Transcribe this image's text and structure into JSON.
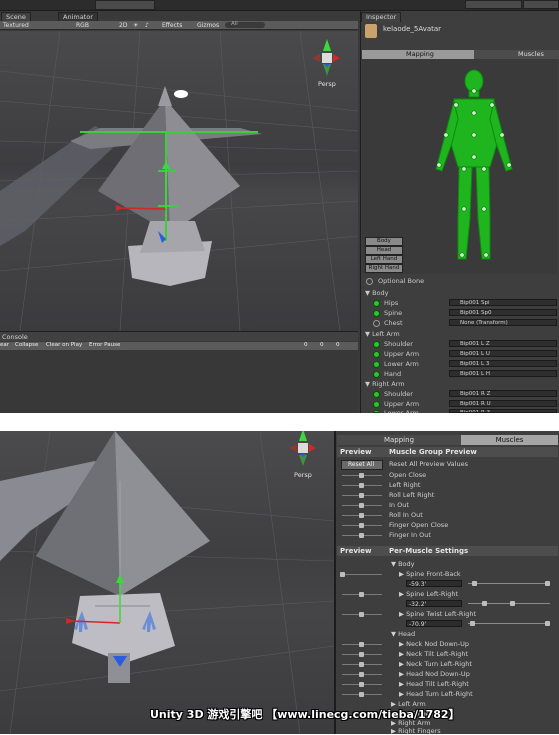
{
  "top": {
    "tabs": {
      "scene": "Scene",
      "animator": "Animator"
    },
    "scene_toolbar": {
      "shading": "Textured",
      "render_mode": "RGB",
      "mode_2d": "2D",
      "effects": "Effects",
      "gizmos": "Gizmos",
      "search": "All"
    },
    "gizmo_label": "Persp",
    "console": {
      "tab": "Console",
      "buttons": [
        "ear",
        "Collapse",
        "Clear on Play",
        "Error Pause"
      ],
      "counts": [
        "0",
        "0",
        "0"
      ]
    },
    "inspector": {
      "tab": "Inspector",
      "object_name": "kelaode_5Avatar",
      "mapping_tab": "Mapping",
      "muscles_tab": "Muscles",
      "body_parts": [
        "Body",
        "Head",
        "Left Hand",
        "Right Hand"
      ],
      "optional_bone": "Optional Bone",
      "groups": {
        "body": "Body",
        "left_arm": "Left Arm",
        "right_arm": "Right Arm"
      },
      "body_rows": [
        {
          "label": "Hips",
          "value": "Bip001 Spi"
        },
        {
          "label": "Spine",
          "value": "Bip001 Sp0"
        },
        {
          "label": "Chest",
          "value": "None (Transform)"
        }
      ],
      "left_arm_rows": [
        {
          "label": "Shoulder",
          "value": "Bip001 L Z"
        },
        {
          "label": "Upper Arm",
          "value": "Bip001 L U"
        },
        {
          "label": "Lower Arm",
          "value": "Bip001 L 3"
        },
        {
          "label": "Hand",
          "value": "Bip001 L H"
        }
      ],
      "right_arm_rows": [
        {
          "label": "Shoulder",
          "value": "Bip001 R Z"
        },
        {
          "label": "Upper Arm",
          "value": "Bip001 R U"
        },
        {
          "label": "Lower Arm",
          "value": "Bip001 R 3"
        }
      ]
    }
  },
  "bottom": {
    "gizmo_label": "Persp",
    "tabs": {
      "mapping": "Mapping",
      "muscles": "Muscles"
    },
    "preview_header": "Preview",
    "muscle_group_header": "Muscle Group Preview",
    "reset_all": "Reset All",
    "muscle_groups": [
      "Reset All Preview Values",
      "Open Close",
      "Left Right",
      "Roll Left Right",
      "In Out",
      "Roll In Out",
      "Finger Open Close",
      "Finger In Out"
    ],
    "per_muscle_preview_header": "Preview",
    "per_muscle_header": "Per-Muscle Settings",
    "body_group": "Body",
    "body_muscles": [
      {
        "label": "Spine Front-Back",
        "value": "-59.3'"
      },
      {
        "label": "Spine Left-Right",
        "value": "-32.2'"
      },
      {
        "label": "Spine Twist Left-Right",
        "value": "-70.9'"
      }
    ],
    "head_group": "Head",
    "head_muscles": [
      "Neck Nod Down-Up",
      "Neck Tilt Left-Right",
      "Neck Turn Left-Right",
      "Head Nod Down-Up",
      "Head Tilt Left-Right",
      "Head Turn Left-Right"
    ],
    "more_groups": [
      "Left Arm",
      "Left Fingers",
      "Right Arm",
      "Right Fingers"
    ]
  },
  "watermark": "Unity 3D 游戏引擎吧 【www.linecg.com/tieba/1782】"
}
